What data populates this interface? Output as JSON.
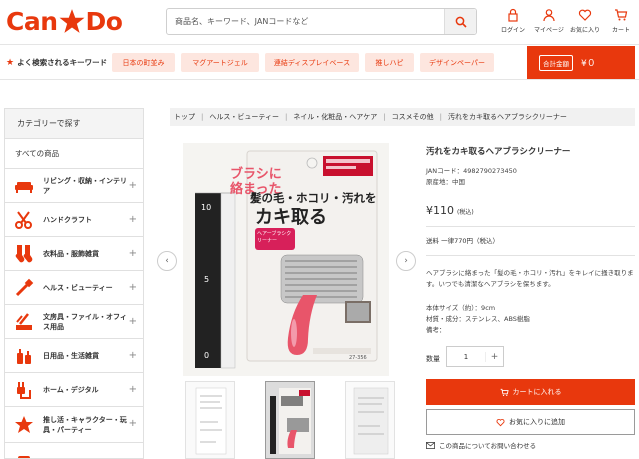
{
  "logo": {
    "left": "Can",
    "right": "Do"
  },
  "search": {
    "placeholder": "商品名、キーワード、JANコードなど"
  },
  "header_icons": [
    {
      "label": "ログイン",
      "icon": "lock-icon"
    },
    {
      "label": "マイページ",
      "icon": "person-icon"
    },
    {
      "label": "お気に入り",
      "icon": "heart-icon"
    },
    {
      "label": "カート",
      "icon": "cart-icon"
    }
  ],
  "keywords": {
    "title": "よく検索されるキーワード",
    "items": [
      "日本の町並み",
      "マグアートジェル",
      "連結ディスプレイベース",
      "推しハピ",
      "デザインペーパー"
    ]
  },
  "cart_total": {
    "label": "合計金額",
    "amount": "¥０"
  },
  "sidebar": {
    "header": "カテゴリーで探す",
    "all": "すべての商品",
    "items": [
      {
        "label": "リビング・収納・インテリア",
        "icon": "sofa-icon"
      },
      {
        "label": "ハンドクラフト",
        "icon": "scissors-icon"
      },
      {
        "label": "衣料品・服飾雑貨",
        "icon": "socks-icon"
      },
      {
        "label": "ヘルス・ビューティー",
        "icon": "brush-icon"
      },
      {
        "label": "文房具・ファイル・オフィス用品",
        "icon": "stationery-icon"
      },
      {
        "label": "日用品・生活雑貨",
        "icon": "bottle-icon"
      },
      {
        "label": "ホーム・デジタル",
        "icon": "plug-icon"
      },
      {
        "label": "推し活・キャラクター・玩具・パーティー",
        "icon": "party-icon"
      },
      {
        "label": "",
        "icon": "food-icon"
      }
    ],
    "expand": "+"
  },
  "breadcrumb": [
    "トップ",
    "ヘルス・ビューティー",
    "ネイル・化粧品・ヘアケア",
    "コスメその他",
    "汚れをカキ取るヘアブラシクリーナー"
  ],
  "package": {
    "line1": "ブラシに",
    "line2": "絡まった",
    "line3": "髪の毛・ホコリ・汚れを",
    "line4": "カキ取る",
    "badge": "ヘアーブラシクリーナー",
    "code": "27-356",
    "scale": [
      "10",
      "5",
      "0"
    ]
  },
  "product": {
    "title": "汚れをカキ取るヘアブラシクリーナー",
    "jan": "JANコード：4982790273450",
    "origin": "原産地：中国",
    "price": "¥110",
    "price_tax": "(税込)",
    "shipping": "送料 一律770円（税込）",
    "description": "ヘアブラシに絡まった「髪の毛・ホコリ・汚れ」をキレイに掻き取ります。いつでも清潔なヘアブラシを保ちます。",
    "size": "本体サイズ（約）：9cm",
    "material": "材質・成分：ステンレス、ABS樹脂",
    "note": "備考："
  },
  "quantity": {
    "label": "数量",
    "value": "1",
    "plus": "+"
  },
  "buttons": {
    "cart": "カートに入れる",
    "favorite": "お気に入りに追加",
    "inquiry": "この商品についてお問い合わせる"
  },
  "colors": {
    "accent": "#e8380d",
    "pink": "#e8556a"
  }
}
